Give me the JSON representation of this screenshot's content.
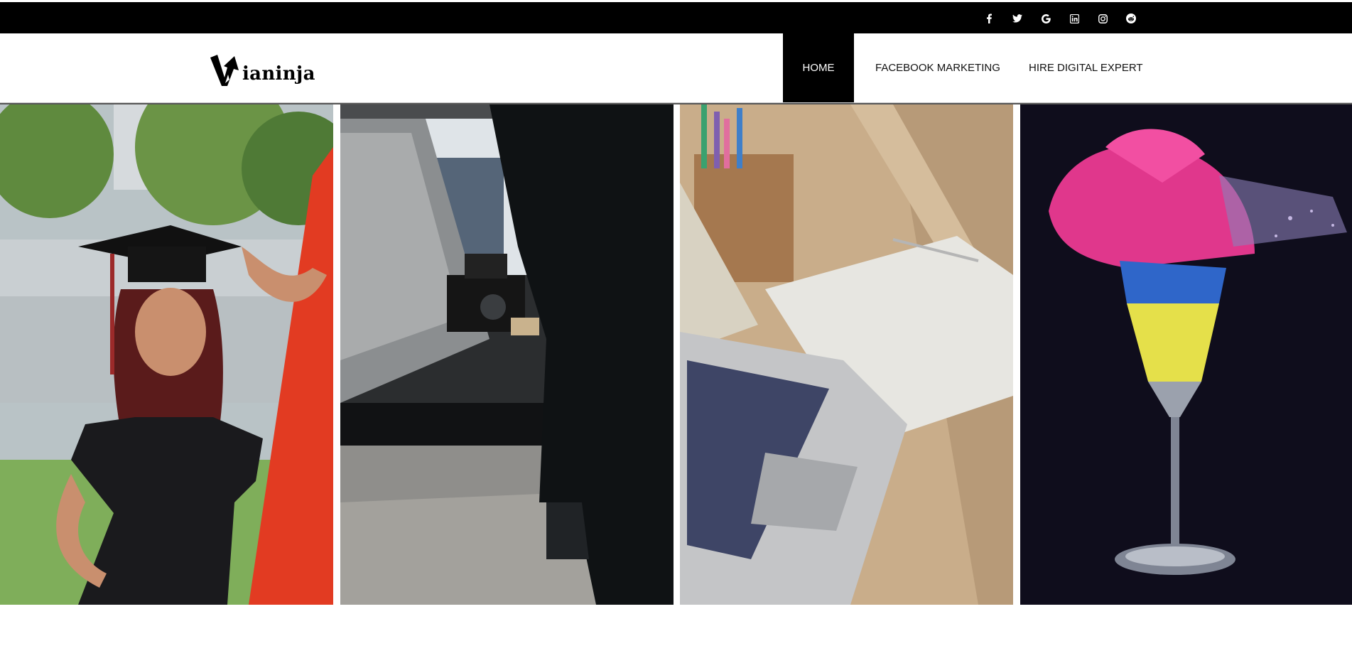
{
  "social": {
    "icons": [
      "facebook-icon",
      "twitter-icon",
      "google-icon",
      "linkedin-icon",
      "instagram-icon",
      "reddit-icon"
    ]
  },
  "brand": {
    "logo_text": "ianinja",
    "logo_initial": "V"
  },
  "nav": {
    "items": [
      {
        "label": "HOME",
        "active": true
      },
      {
        "label": "FACEBOOK MARKETING",
        "active": false
      },
      {
        "label": "HIRE DIGITAL EXPERT",
        "active": false
      }
    ]
  },
  "gallery": {
    "panels": [
      "graduate-photo",
      "camera-operator-photo",
      "laptop-desk-photo",
      "exploding-glass-photo"
    ]
  },
  "colors": {
    "topbar": "#000000",
    "nav_active_bg": "#000000",
    "nav_active_text": "#ffffff",
    "nav_text": "#111111"
  }
}
